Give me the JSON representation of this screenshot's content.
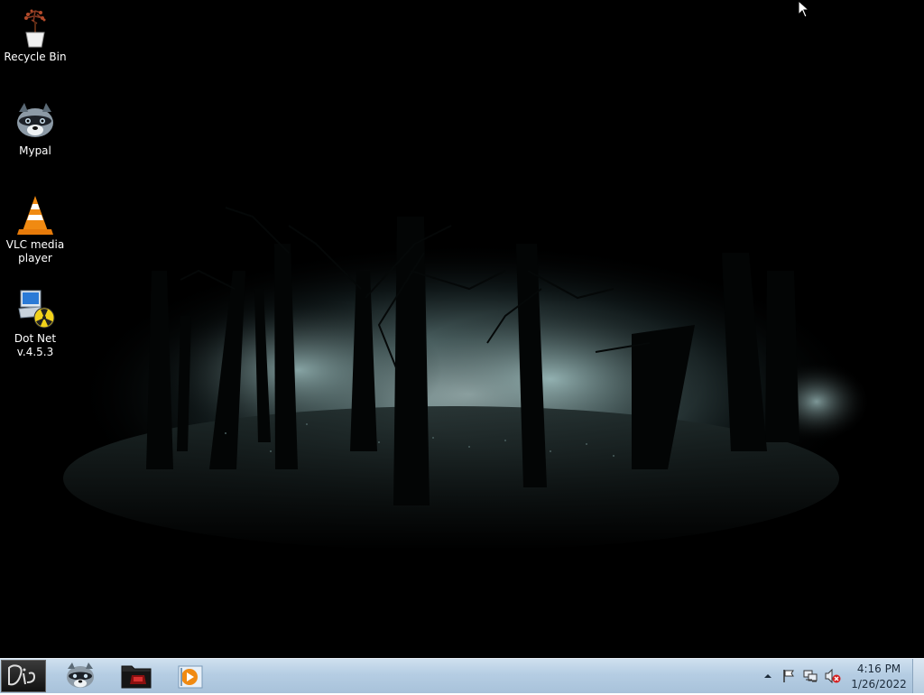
{
  "desktop": {
    "icons": [
      {
        "label": "Recycle Bin",
        "icon": "recycle-bin-icon"
      },
      {
        "label": "Mypal",
        "icon": "raccoon-icon"
      },
      {
        "label": "VLC media player",
        "icon": "vlc-cone-icon"
      },
      {
        "label": "Dot Net v.4.5.3",
        "icon": "dotnet-installer-icon"
      }
    ],
    "wallpaper": "dark-foggy-forest"
  },
  "taskbar": {
    "start_button": "start-orb-icon",
    "pinned": [
      {
        "name": "Mypal",
        "icon": "raccoon-icon"
      },
      {
        "name": "Explorer",
        "icon": "folder-icon"
      },
      {
        "name": "Media Player",
        "icon": "media-player-icon"
      }
    ],
    "tray": {
      "icons": [
        "show-hidden-icons-arrow",
        "action-center-flag-icon",
        "network-icon",
        "volume-muted-icon"
      ],
      "time": "4:16 PM",
      "date": "1/26/2022"
    }
  },
  "colors": {
    "taskbar": "#b5cde3",
    "desktop_bg": "#000000",
    "fog": "#a9c4c4"
  }
}
